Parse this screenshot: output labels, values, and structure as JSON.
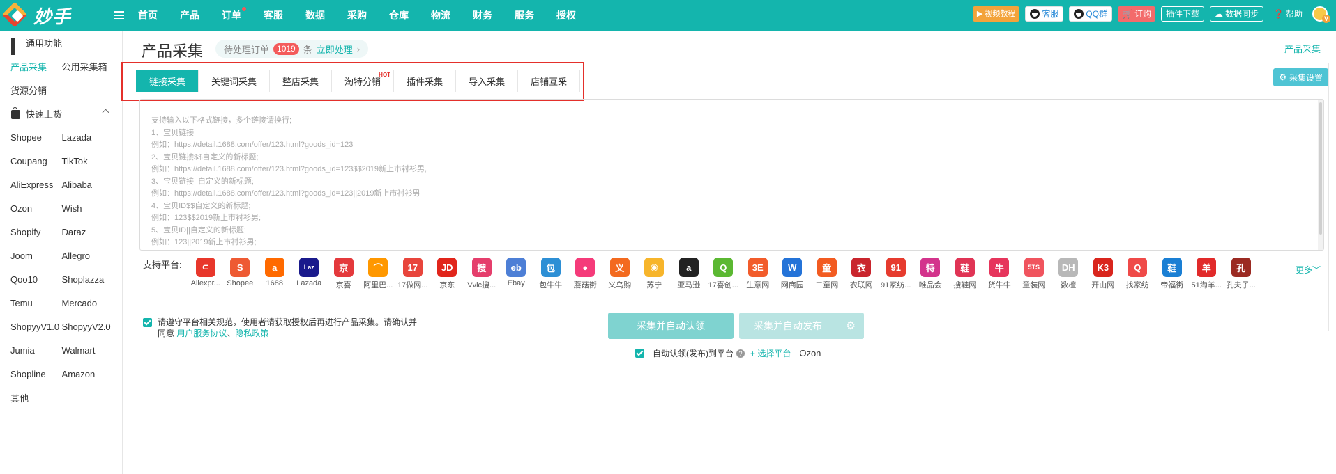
{
  "app": {
    "logo_text": "妙手"
  },
  "nav": [
    {
      "label": "首页"
    },
    {
      "label": "产品"
    },
    {
      "label": "订单",
      "dot": true
    },
    {
      "label": "客服"
    },
    {
      "label": "数据"
    },
    {
      "label": "采购"
    },
    {
      "label": "仓库"
    },
    {
      "label": "物流"
    },
    {
      "label": "财务"
    },
    {
      "label": "服务"
    },
    {
      "label": "授权"
    }
  ],
  "topright": {
    "video": "视频教程",
    "kefu": "客服",
    "qq": "QQ群",
    "order": "订购",
    "plugin": "插件下载",
    "sync": "数据同步",
    "help": "帮助"
  },
  "sidebar": {
    "section1": "通用功能",
    "row1": [
      "产品采集",
      "公用采集箱"
    ],
    "row2": "货源分销",
    "section2": "快速上货",
    "platforms": [
      [
        "Shopee",
        "Lazada"
      ],
      [
        "Coupang",
        "TikTok"
      ],
      [
        "AliExpress",
        "Alibaba"
      ],
      [
        "Ozon",
        "Wish"
      ],
      [
        "Shopify",
        "Daraz"
      ],
      [
        "Joom",
        "Allegro"
      ],
      [
        "Qoo10",
        "Shoplazza"
      ],
      [
        "Temu",
        "Mercado"
      ],
      [
        "ShopyyV1.0",
        "ShopyyV2.0"
      ],
      [
        "Jumia",
        "Walmart"
      ],
      [
        "Shopline",
        "Amazon"
      ]
    ],
    "other": "其他"
  },
  "main": {
    "title": "产品采集",
    "pending_label": "待处理订单",
    "pending_count": "1019",
    "pending_unit": "条",
    "pending_link": "立即处理",
    "breadcrumb_right": "产品采集",
    "tabs": [
      {
        "label": "链接采集",
        "active": true
      },
      {
        "label": "关键词采集"
      },
      {
        "label": "整店采集"
      },
      {
        "label": "淘特分销",
        "hot": "HOT"
      },
      {
        "label": "插件采集"
      },
      {
        "label": "导入采集"
      },
      {
        "label": "店铺互采"
      }
    ],
    "settings_label": "采集设置",
    "placeholder_lines": [
      "支持输入以下格式链接，多个链接请换行;",
      "1、宝贝链接",
      "例如：https://detail.1688.com/offer/123.html?goods_id=123",
      "2、宝贝链接$$自定义的新标题;",
      "例如：https://detail.1688.com/offer/123.html?goods_id=123$$2019新上市衬衫男,",
      "3、宝贝链接||自定义的新标题;",
      "例如：https://detail.1688.com/offer/123.html?goods_id=123||2019新上市衬衫男",
      "4、宝贝ID$$自定义的新标题;",
      "例如：123$$2019新上市衬衫男;",
      "5、宝贝ID||自定义的新标题;",
      "例如：123||2019新上市衬衫男;"
    ],
    "platforms_label": "支持平台:",
    "platforms": [
      {
        "name": "Aliexpr...",
        "glyph": "⊂",
        "color": "#e8372b"
      },
      {
        "name": "Shopee",
        "glyph": "S",
        "color": "#ee5a33"
      },
      {
        "name": "1688",
        "glyph": "a",
        "color": "#ff6a00"
      },
      {
        "name": "Lazada",
        "glyph": "Laz",
        "color": "#1a1a8c"
      },
      {
        "name": "京喜",
        "glyph": "京",
        "color": "#e4393c"
      },
      {
        "name": "阿里巴...",
        "glyph": "⌒",
        "color": "#ff9800"
      },
      {
        "name": "17做网...",
        "glyph": "17",
        "color": "#e8453c"
      },
      {
        "name": "京东",
        "glyph": "JD",
        "color": "#e1251b"
      },
      {
        "name": "Vvic搜...",
        "glyph": "搜",
        "color": "#e53e6c"
      },
      {
        "name": "Ebay",
        "glyph": "eb",
        "color": "#4d7fd6"
      },
      {
        "name": "包牛牛",
        "glyph": "包",
        "color": "#2d8fd5"
      },
      {
        "name": "蘑菇街",
        "glyph": "●",
        "color": "#f53b7a"
      },
      {
        "name": "义乌购",
        "glyph": "义",
        "color": "#f36a1f"
      },
      {
        "name": "苏宁",
        "glyph": "◉",
        "color": "#f7b52b"
      },
      {
        "name": "亚马逊",
        "glyph": "a",
        "color": "#222222"
      },
      {
        "name": "17喜创...",
        "glyph": "Q",
        "color": "#5bb832"
      },
      {
        "name": "生意网",
        "glyph": "3E",
        "color": "#f25c2b"
      },
      {
        "name": "网商园",
        "glyph": "W",
        "color": "#2473d8"
      },
      {
        "name": "二童网",
        "glyph": "童",
        "color": "#f25b21"
      },
      {
        "name": "衣联网",
        "glyph": "衣",
        "color": "#c9252d"
      },
      {
        "name": "91家纺...",
        "glyph": "91",
        "color": "#e63b2e"
      },
      {
        "name": "唯品会",
        "glyph": "特",
        "color": "#d3338c"
      },
      {
        "name": "搜鞋网",
        "glyph": "鞋",
        "color": "#e03455"
      },
      {
        "name": "货牛牛",
        "glyph": "牛",
        "color": "#e6355c"
      },
      {
        "name": "童装网",
        "glyph": "5TS",
        "color": "#f0545e"
      },
      {
        "name": "数檀",
        "glyph": "DH",
        "color": "#b8b8b8"
      },
      {
        "name": "开山网",
        "glyph": "K3",
        "color": "#d9251d"
      },
      {
        "name": "找家纺",
        "glyph": "Q",
        "color": "#ef4a48"
      },
      {
        "name": "帝福街",
        "glyph": "鞋",
        "color": "#1a7fd4"
      },
      {
        "name": "51淘羊...",
        "glyph": "羊",
        "color": "#e12a2a"
      },
      {
        "name": "孔夫子...",
        "glyph": "孔",
        "color": "#9b2a22"
      }
    ],
    "more_label": "更多",
    "agree_text": "请遵守平台相关规范，使用者请获取授权后再进行产品采集。请确认并同意",
    "agree_link1": "用户服务协议",
    "agree_sep": "、",
    "agree_link2": "隐私政策",
    "btn_claim": "采集并自动认领",
    "btn_publish": "采集并自动发布",
    "auto_text": "自动认领(发布)到平台",
    "select_platform": "+ 选择平台",
    "selected_platform": "Ozon"
  }
}
